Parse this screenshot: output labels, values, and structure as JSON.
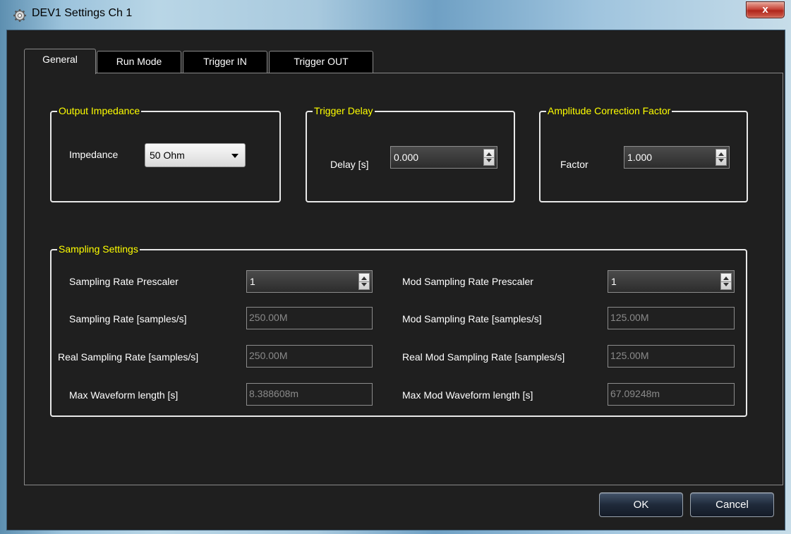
{
  "window": {
    "title": "DEV1 Settings Ch 1",
    "close_label": "x"
  },
  "tabs": [
    {
      "label": "General",
      "active": true
    },
    {
      "label": "Run Mode",
      "active": false
    },
    {
      "label": "Trigger IN",
      "active": false
    },
    {
      "label": "Trigger OUT",
      "active": false
    }
  ],
  "output_impedance": {
    "title": "Output Impedance",
    "label": "Impedance",
    "value": "50 Ohm"
  },
  "trigger_delay": {
    "title": "Trigger Delay",
    "label": "Delay [s]",
    "value": "0.000"
  },
  "amplitude_correction": {
    "title": "Amplitude Correction Factor",
    "label": "Factor",
    "value": "1.000"
  },
  "sampling": {
    "title": "Sampling Settings",
    "left": [
      {
        "label": "Sampling Rate Prescaler",
        "value": "1"
      },
      {
        "label": "Sampling Rate [samples/s]",
        "value": "250.00M"
      },
      {
        "label": "Real Sampling Rate [samples/s]",
        "value": "250.00M"
      },
      {
        "label": "Max Waveform length [s]",
        "value": "8.388608m"
      }
    ],
    "right": [
      {
        "label": "Mod Sampling Rate Prescaler",
        "value": "1"
      },
      {
        "label": "Mod Sampling Rate [samples/s]",
        "value": "125.00M"
      },
      {
        "label": "Real Mod Sampling Rate [samples/s]",
        "value": "125.00M"
      },
      {
        "label": "Max Mod Waveform length [s]",
        "value": "67.09248m"
      }
    ]
  },
  "buttons": {
    "ok": "OK",
    "cancel": "Cancel"
  },
  "colors": {
    "group_title": "#ffff00",
    "background": "#1f1f1f",
    "close_button": "#c7463a"
  },
  "icons": {
    "title": "gear-icon"
  }
}
